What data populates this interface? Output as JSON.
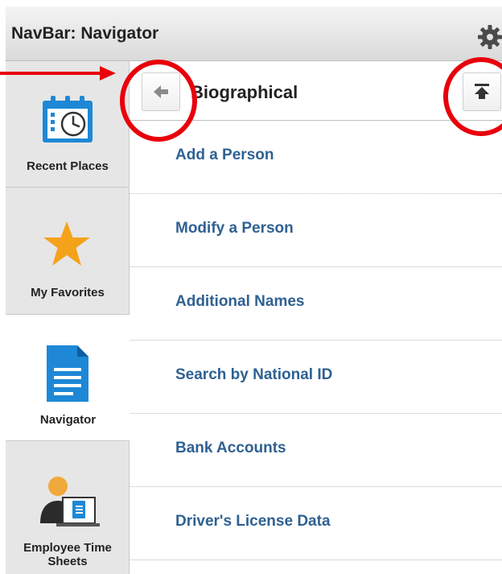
{
  "titlebar": {
    "title": "NavBar: Navigator"
  },
  "rail": {
    "tiles": [
      {
        "label": "Recent Places",
        "icon": "calendar-clock-icon"
      },
      {
        "label": "My Favorites",
        "icon": "star-icon"
      },
      {
        "label": "Navigator",
        "icon": "document-icon",
        "active": true
      },
      {
        "label": "Employee Time Sheets",
        "icon": "employee-timesheet-icon"
      }
    ]
  },
  "panel": {
    "title": "Biographical",
    "items": [
      {
        "label": "Add a Person"
      },
      {
        "label": "Modify a Person"
      },
      {
        "label": "Additional Names"
      },
      {
        "label": "Search by National ID"
      },
      {
        "label": "Bank Accounts"
      },
      {
        "label": "Driver's License Data"
      }
    ]
  },
  "colors": {
    "link": "#2f6192",
    "star": "#f5a21b",
    "icon_blue": "#1e88d6",
    "annotation_red": "#e8000b"
  }
}
